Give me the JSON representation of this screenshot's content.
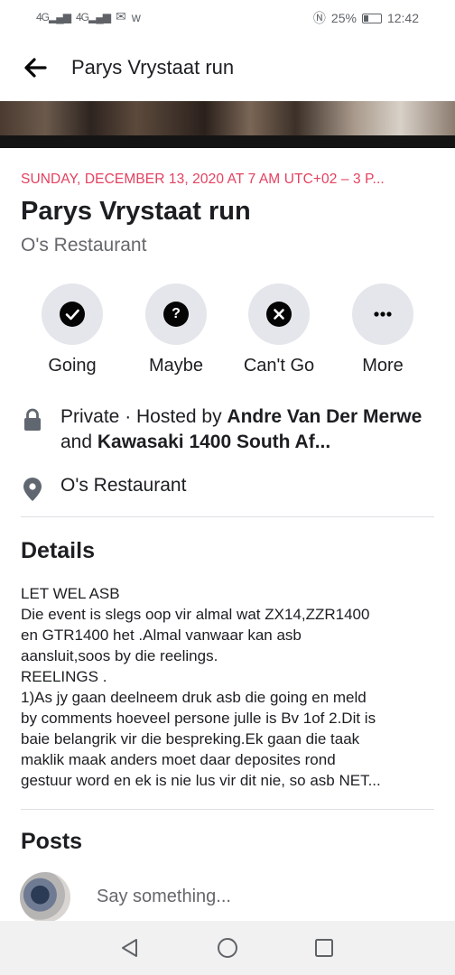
{
  "status_bar": {
    "network1": "4G",
    "network2": "4G",
    "battery": "25%",
    "time": "12:42"
  },
  "app_bar": {
    "title": "Parys Vrystaat run"
  },
  "event": {
    "date_line": "SUNDAY, DECEMBER 13, 2020 AT 7 AM UTC+02 – 3 P...",
    "title": "Parys Vrystaat run",
    "venue": "O's Restaurant"
  },
  "actions": [
    {
      "label": "Going",
      "icon": "check-icon"
    },
    {
      "label": "Maybe",
      "icon": "question-icon"
    },
    {
      "label": "Can't Go",
      "icon": "x-icon"
    },
    {
      "label": "More",
      "icon": "more-dots-icon"
    }
  ],
  "info": {
    "privacy_prefix": "Private · Hosted by ",
    "host1": "Andre Van Der Merwe",
    "and": " and ",
    "host2": "Kawasaki 1400 South Af...",
    "location": "O's Restaurant"
  },
  "details": {
    "heading": "Details",
    "lines": [
      "LET WEL ASB",
      "Die event is slegs oop vir almal wat ZX14,ZZR1400",
      "en GTR1400 het .Almal vanwaar kan asb",
      "aansluit,soos by die reelings.",
      "REELINGS .",
      "1)As jy gaan deelneem druk asb die going en meld",
      "by comments hoeveel persone  julle is Bv 1of 2.Dit is",
      "baie belangrik vir die bespreking.Ek gaan die taak",
      "maklik maak anders moet daar deposites rond",
      "gestuur word en ek is nie lus vir dit nie, so asb NET..."
    ]
  },
  "posts": {
    "heading": "Posts",
    "placeholder": "Say something..."
  }
}
